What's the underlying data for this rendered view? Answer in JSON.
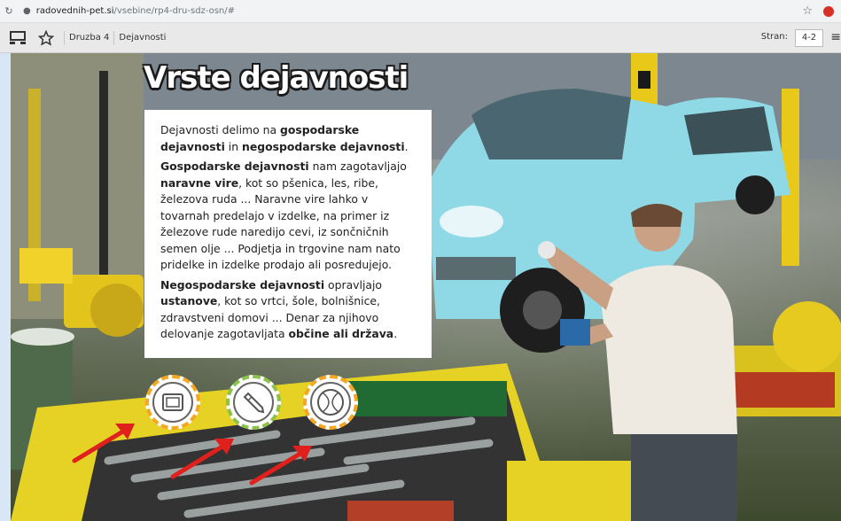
{
  "browser": {
    "reload_glyph": "↻",
    "lock_glyph": "🔒",
    "url_host": "radovednih-pet.si",
    "url_path": "/vsebine/rp4-dru-sdz-osn/#",
    "star_glyph": "☆"
  },
  "toolbar": {
    "menu_icon": "monitor-icon",
    "bookmark_icon": "star-icon",
    "breadcrumb": [
      "Druzba 4",
      "Dejavnosti"
    ],
    "page_label": "Stran:",
    "page_value": "4-2"
  },
  "slide": {
    "title": "Vrste dejavnosti",
    "p1_pre": "Dejavnosti delimo na ",
    "p1_b1": "gospodarske dejavnosti",
    "p1_mid": " in ",
    "p1_b2": "negospodarske dejavnosti",
    "p1_end": ".",
    "p2_b1": "Gospodarske dejavnosti",
    "p2_t1": " nam zagotavljajo ",
    "p2_b2": "naravne vire",
    "p2_t2": ", kot so pšenica, les, ribe, železova ruda ... Naravne vire lahko v tovarnah predelajo v izdelke, na primer iz železove rude naredijo cevi, iz sončničnih semen olje ... Podjetja in trgovine nam nato pridelke in izdelke prodajo ali posredujejo.",
    "p3_b1": "Negospodarske dejavnosti",
    "p3_t1": " opravljajo ",
    "p3_b2": "ustanove",
    "p3_t2": ", kot so vrtci, šole, bolnišnice, zdravstveni domovi ... Denar za njihovo delovanje zagotavljata ",
    "p3_b3": "občine ali država",
    "p3_end": "."
  },
  "buttons": [
    {
      "name": "tablet-button",
      "icon": "tablet-icon",
      "ring": "orange"
    },
    {
      "name": "pencil-button",
      "icon": "pencil-icon",
      "ring": "green"
    },
    {
      "name": "ball-button",
      "icon": "ball-icon",
      "ring": "orange"
    }
  ],
  "colors": {
    "arrow": "#e0201c",
    "ring_orange": "#f5a623",
    "ring_green": "#8bc34a"
  }
}
